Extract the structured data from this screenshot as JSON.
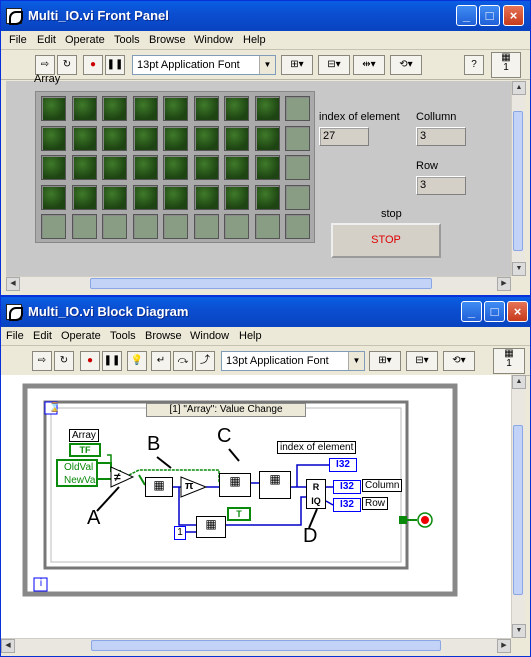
{
  "front_panel": {
    "title": "Multi_IO.vi Front Panel",
    "menu": [
      "File",
      "Edit",
      "Operate",
      "Tools",
      "Browse",
      "Window",
      "Help"
    ],
    "font": "13pt Application Font",
    "array_label": "Array",
    "index_label": "index of element",
    "index_value": "27",
    "column_label": "Collumn",
    "column_value": "3",
    "row_label": "Row",
    "row_value": "3",
    "stop_label": "stop",
    "stop_button": "STOP",
    "vi_number": "1",
    "led_grid": [
      [
        1,
        1,
        1,
        1,
        1,
        1,
        1,
        1,
        0
      ],
      [
        1,
        1,
        1,
        1,
        1,
        1,
        1,
        1,
        0
      ],
      [
        1,
        1,
        1,
        1,
        1,
        1,
        1,
        1,
        0
      ],
      [
        1,
        1,
        1,
        1,
        1,
        1,
        1,
        1,
        0
      ],
      [
        0,
        0,
        0,
        0,
        0,
        0,
        0,
        0,
        0
      ]
    ]
  },
  "block_diagram": {
    "title": "Multi_IO.vi Block Diagram",
    "menu": [
      "File",
      "Edit",
      "Operate",
      "Tools",
      "Browse",
      "Window",
      "Help"
    ],
    "font": "13pt Application Font",
    "case_selector": "[1] \"Array\": Value Change",
    "array_terminal": "Array",
    "tf_text": "TF",
    "oldval": "OldVal",
    "newval": "NewVal",
    "index_terminal": "index of element",
    "column_terminal": "Column",
    "row_terminal": "Row",
    "i32": "I32",
    "const_one": "1",
    "iter": "i",
    "labels": {
      "a": "A",
      "b": "B",
      "c": "C",
      "d": "D"
    },
    "vi_number": "1"
  }
}
